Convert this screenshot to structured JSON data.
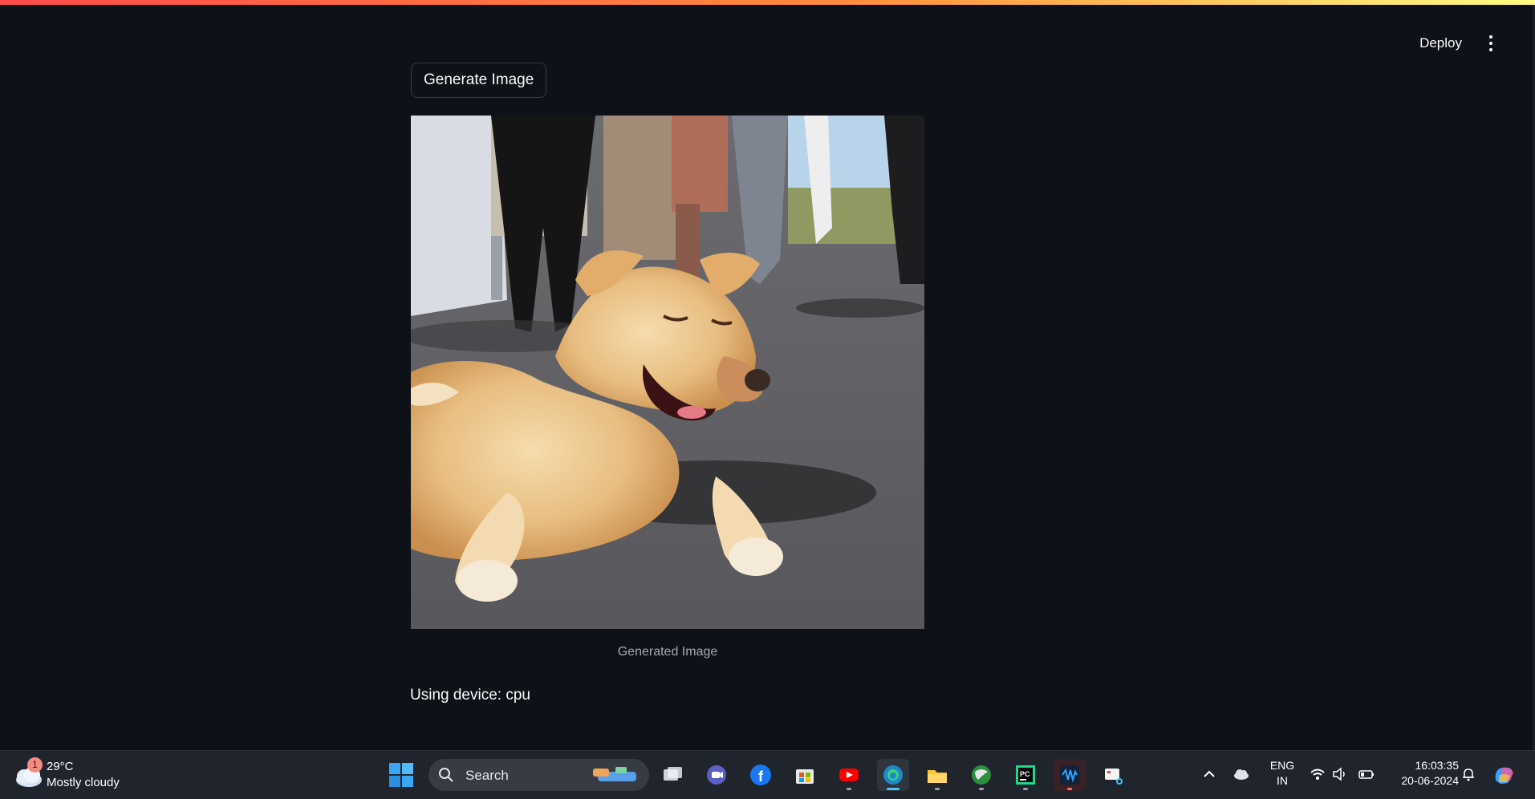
{
  "header": {
    "deploy_label": "Deploy",
    "menu_icon": "kebab-menu-icon",
    "decoration_colors": [
      "#ff4b4b",
      "#ff8c3a",
      "#fffd80"
    ]
  },
  "main": {
    "generate_button_label": "Generate Image",
    "image_caption": "Generated Image",
    "device_text": "Using device: cpu"
  },
  "taskbar": {
    "weather": {
      "badge_count": "1",
      "temperature": "29°C",
      "condition": "Mostly cloudy",
      "icon": "cloudy-weather-icon"
    },
    "search_placeholder": "Search",
    "apps": [
      {
        "name": "task-view",
        "icon": "task-view-icon"
      },
      {
        "name": "teams-meet",
        "icon": "video-chat-icon"
      },
      {
        "name": "facebook",
        "icon": "facebook-icon"
      },
      {
        "name": "microsoft-store",
        "icon": "store-icon"
      },
      {
        "name": "youtube",
        "icon": "youtube-icon"
      },
      {
        "name": "edge",
        "icon": "edge-browser-icon"
      },
      {
        "name": "file-explorer",
        "icon": "folder-icon"
      },
      {
        "name": "browser",
        "icon": "globe-browser-icon"
      },
      {
        "name": "pycharm",
        "icon": "pycharm-icon"
      },
      {
        "name": "audio-app",
        "icon": "waveform-app-icon"
      },
      {
        "name": "snipping-tool",
        "icon": "snipping-tool-icon"
      }
    ],
    "tray": {
      "language_line1": "ENG",
      "language_line2": "IN",
      "time": "16:03:35",
      "date": "20-06-2024"
    },
    "accent_color": "#4cc2ff"
  }
}
